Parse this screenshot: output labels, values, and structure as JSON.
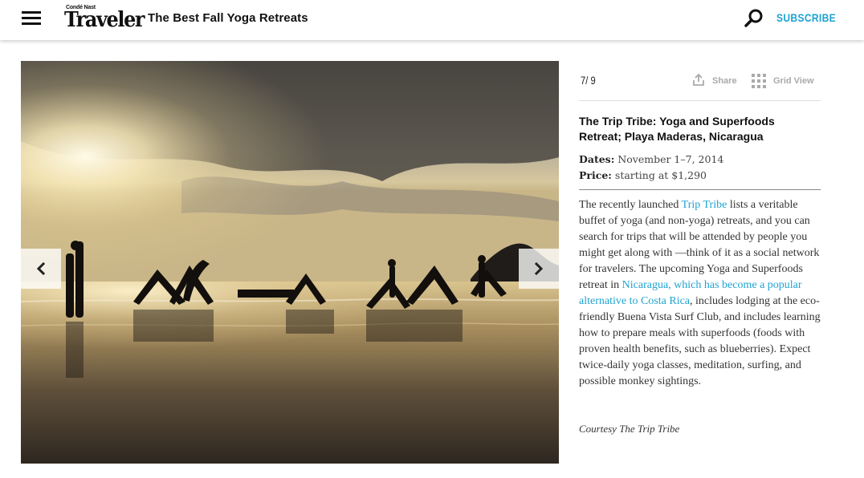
{
  "header": {
    "logo_small": "Condé Nast",
    "logo_main": "Traveler",
    "title": "The Best Fall Yoga Retreats",
    "subscribe_label": "SUBSCRIBE",
    "menu_icon": "hamburger-icon",
    "search_icon": "search-icon"
  },
  "gallery": {
    "counter": "7/ 9",
    "share_label": "Share",
    "grid_label": "Grid View",
    "prev_icon": "chevron-left-icon",
    "next_icon": "chevron-right-icon",
    "image_alt": "Silhouettes of people doing yoga on a beach at sunset"
  },
  "slide": {
    "title": "The Trip Tribe: Yoga and Superfoods Retreat; Playa Maderas, Nicaragua",
    "dates_label": "Dates:",
    "dates_value": "November 1–7, 2014",
    "price_label": "Price:",
    "price_value": "starting at $1,290",
    "body": [
      {
        "text": "The recently launched ",
        "link": false
      },
      {
        "text": "Trip Tribe",
        "link": true
      },
      {
        "text": " lists a veritable buffet of yoga (and non-yoga) retreats, and you can search for trips that will be attended by people you might get along with —think of it as a social network for travelers. The upcoming Yoga and Superfoods retreat in ",
        "link": false
      },
      {
        "text": "Nicaragua, which has become a popular alternative to Costa Rica",
        "link": true
      },
      {
        "text": ", includes lodging at the eco-friendly Buena Vista Surf Club, and includes learning how to prepare meals with superfoods (foods with proven health benefits, such as blueberries). Expect twice-daily yoga classes, meditation, surfing, and possible monkey sightings.",
        "link": false
      }
    ],
    "credit": "Courtesy The Trip Tribe"
  },
  "colors": {
    "accent": "#1fa3d1",
    "muted": "#aaaaaa"
  }
}
